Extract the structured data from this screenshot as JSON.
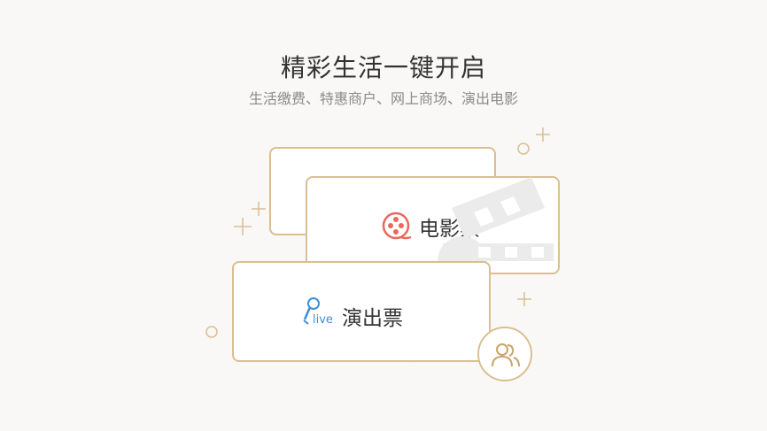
{
  "promo": {
    "title": "精彩生活一键开启",
    "subtitle": "生活缴费、特惠商户、网上商场、演出电影"
  },
  "cards": {
    "movie": {
      "label": "电影票",
      "icon": "film-reel-icon"
    },
    "show": {
      "label": "演出票",
      "icon": "microphone-live-icon",
      "icon_text": "live"
    }
  },
  "badge": {
    "icon": "friends-icon"
  },
  "colors": {
    "background": "#f9f8f6",
    "card_border": "#d9bf91",
    "accent_red": "#e8695c",
    "accent_blue": "#3d8fd6",
    "watermark": "#ebebeb"
  }
}
